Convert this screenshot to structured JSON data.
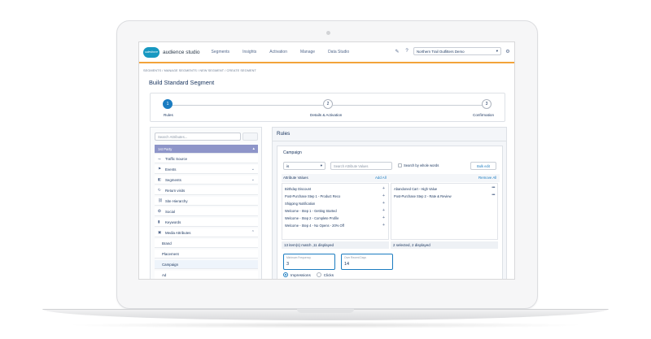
{
  "app": {
    "logo_text": "salesforce",
    "name": "audience studio"
  },
  "nav": [
    "Segments",
    "Insights",
    "Activation",
    "Manage",
    "Data Studio"
  ],
  "org_select": {
    "value": "Northern Trail Outfitters Demo"
  },
  "breadcrumb": "SEGMENTS  /  MANAGE SEGMENTS  /  NEW SEGMENT  /  CREATE SEGMENT",
  "page_title": "Build Standard Segment",
  "wizard": {
    "steps": [
      {
        "num": "1",
        "label": "Rules"
      },
      {
        "num": "2",
        "label": "Details & Activation"
      },
      {
        "num": "3",
        "label": "Confirmation"
      }
    ]
  },
  "attributes": {
    "search_placeholder": "Search Attributes...",
    "header": "1st Party",
    "items": [
      "Traffic Source",
      "Events",
      "Segments",
      "Return visits",
      "Site Hierarchy",
      "Social",
      "Keywords",
      "Media Attributes"
    ],
    "sub_items": [
      "Brand",
      "Placement",
      "Campaign",
      "Ad"
    ]
  },
  "rules": {
    "title": "Rules",
    "campaign": "Campaign",
    "operator": "is",
    "value_search_placeholder": "Search Attribute Values",
    "whole_words_label": "Search by whole words",
    "bulk_edit": "Bulk edit",
    "values_header": "Attribute Values",
    "add_all": "Add All",
    "remove_all": "Remove All",
    "values": [
      "Birthday Discount",
      "Post-Purchase Step 1 - Product Reco",
      "Shipping Notification",
      "Welcome - Step 1 - Getting Started",
      "Welcome - Step 2 - Complete Profile",
      "Welcome - Step 4 - No Opens - 20% Off"
    ],
    "selected": [
      "Abandoned Cart - High Value",
      "Post-Purchase Step 2 - Rate & Review"
    ],
    "match_count": "13 item(s) match ,11 displayed",
    "selected_count": "2 selected, 2 displayed",
    "min_frequency_label": "Minimum Frequency",
    "min_frequency_value": "3",
    "recent_days_label": "Over Recent Days",
    "recent_days_value": "14",
    "impressions": "Impressions",
    "clicks": "Clicks"
  },
  "colors": {
    "accent": "#1b7cc1",
    "header_bar": "#8e95c9",
    "topbar_border": "#f2a33a"
  }
}
